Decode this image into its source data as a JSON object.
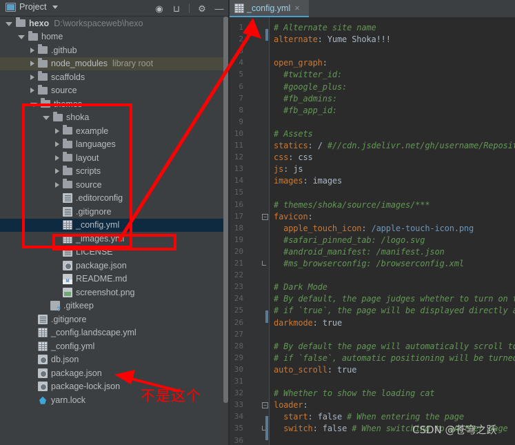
{
  "panel": {
    "title": "Project",
    "icons": [
      "target-icon",
      "collapse-all-icon",
      "settings-gear-icon",
      "minimize-icon"
    ]
  },
  "tree": [
    {
      "depth": 0,
      "arrow": "open",
      "icon": "folder",
      "name": "hexo",
      "bold": true,
      "suffix": "D:\\workspaceweb\\hexo",
      "suffix_kind": "path"
    },
    {
      "depth": 1,
      "arrow": "open",
      "icon": "folder",
      "name": "home"
    },
    {
      "depth": 2,
      "arrow": "closed",
      "icon": "folder",
      "name": ".github"
    },
    {
      "depth": 2,
      "arrow": "closed",
      "icon": "folder",
      "name": "node_modules",
      "suffix": "library root",
      "suffix_kind": "lib",
      "highlight": "lib"
    },
    {
      "depth": 2,
      "arrow": "closed",
      "icon": "folder",
      "name": "scaffolds"
    },
    {
      "depth": 2,
      "arrow": "closed",
      "icon": "folder",
      "name": "source"
    },
    {
      "depth": 2,
      "arrow": "open",
      "icon": "folder",
      "name": "themes"
    },
    {
      "depth": 3,
      "arrow": "open",
      "icon": "folder",
      "name": "shoka"
    },
    {
      "depth": 4,
      "arrow": "closed",
      "icon": "folder",
      "name": "example"
    },
    {
      "depth": 4,
      "arrow": "closed",
      "icon": "folder",
      "name": "languages"
    },
    {
      "depth": 4,
      "arrow": "closed",
      "icon": "folder",
      "name": "layout"
    },
    {
      "depth": 4,
      "arrow": "closed",
      "icon": "folder",
      "name": "scripts"
    },
    {
      "depth": 4,
      "arrow": "closed",
      "icon": "folder",
      "name": "source"
    },
    {
      "depth": 4,
      "arrow": "none",
      "icon": "txt",
      "name": ".editorconfig"
    },
    {
      "depth": 4,
      "arrow": "none",
      "icon": "txt",
      "name": ".gitignore"
    },
    {
      "depth": 4,
      "arrow": "none",
      "icon": "yml",
      "name": "_config.yml",
      "selected": true
    },
    {
      "depth": 4,
      "arrow": "none",
      "icon": "yml",
      "name": "_images.yml"
    },
    {
      "depth": 4,
      "arrow": "none",
      "icon": "txt",
      "name": "LICENSE"
    },
    {
      "depth": 4,
      "arrow": "none",
      "icon": "json",
      "name": "package.json"
    },
    {
      "depth": 4,
      "arrow": "none",
      "icon": "md",
      "name": "README.md"
    },
    {
      "depth": 4,
      "arrow": "none",
      "icon": "png",
      "name": "screenshot.png"
    },
    {
      "depth": 3,
      "arrow": "none",
      "icon": "unk",
      "name": ".gitkeep"
    },
    {
      "depth": 2,
      "arrow": "none",
      "icon": "txt",
      "name": ".gitignore"
    },
    {
      "depth": 2,
      "arrow": "none",
      "icon": "yml",
      "name": "_config.landscape.yml"
    },
    {
      "depth": 2,
      "arrow": "none",
      "icon": "yml",
      "name": "_config.yml"
    },
    {
      "depth": 2,
      "arrow": "none",
      "icon": "json",
      "name": "db.json"
    },
    {
      "depth": 2,
      "arrow": "none",
      "icon": "json",
      "name": "package.json"
    },
    {
      "depth": 2,
      "arrow": "none",
      "icon": "json",
      "name": "package-lock.json"
    },
    {
      "depth": 2,
      "arrow": "none",
      "icon": "yarn",
      "name": "yarn.lock"
    }
  ],
  "editor": {
    "tab": {
      "label": "_config.yml",
      "icon": "yml-file-icon",
      "close": "×"
    },
    "lines": [
      {
        "n": 1,
        "segs": [
          {
            "t": "# Alternate site name",
            "c": "c"
          }
        ]
      },
      {
        "n": 2,
        "segs": [
          {
            "t": "alternate",
            "c": "k"
          },
          {
            "t": ": ",
            "c": "p"
          },
          {
            "t": "Yume Shoka!!!",
            "c": "v"
          }
        ]
      },
      {
        "n": 3,
        "segs": []
      },
      {
        "n": 4,
        "segs": [
          {
            "t": "open_graph",
            "c": "k"
          },
          {
            "t": ":",
            "c": "p"
          }
        ]
      },
      {
        "n": 5,
        "segs": [
          {
            "t": "  #twitter_id:",
            "c": "c"
          }
        ]
      },
      {
        "n": 6,
        "segs": [
          {
            "t": "  #google_plus:",
            "c": "c"
          }
        ]
      },
      {
        "n": 7,
        "segs": [
          {
            "t": "  #fb_admins:",
            "c": "c"
          }
        ]
      },
      {
        "n": 8,
        "segs": [
          {
            "t": "  #fb_app_id:",
            "c": "c"
          }
        ]
      },
      {
        "n": 9,
        "segs": []
      },
      {
        "n": 10,
        "segs": [
          {
            "t": "# Assets",
            "c": "c"
          }
        ]
      },
      {
        "n": 11,
        "segs": [
          {
            "t": "statics",
            "c": "k"
          },
          {
            "t": ": ",
            "c": "p"
          },
          {
            "t": "/ ",
            "c": "v"
          },
          {
            "t": "#//cdn.jsdelivr.net/gh/username/Repository@version/",
            "c": "c"
          }
        ]
      },
      {
        "n": 12,
        "segs": [
          {
            "t": "css",
            "c": "k"
          },
          {
            "t": ": ",
            "c": "p"
          },
          {
            "t": "css",
            "c": "v"
          }
        ]
      },
      {
        "n": 13,
        "segs": [
          {
            "t": "js",
            "c": "k"
          },
          {
            "t": ": ",
            "c": "p"
          },
          {
            "t": "js",
            "c": "v"
          }
        ]
      },
      {
        "n": 14,
        "segs": [
          {
            "t": "images",
            "c": "k"
          },
          {
            "t": ": ",
            "c": "p"
          },
          {
            "t": "images",
            "c": "v"
          }
        ]
      },
      {
        "n": 15,
        "segs": []
      },
      {
        "n": 16,
        "segs": [
          {
            "t": "# themes/shoka/source/images/***",
            "c": "c"
          }
        ]
      },
      {
        "n": 17,
        "segs": [
          {
            "t": "favicon",
            "c": "k"
          },
          {
            "t": ":",
            "c": "p"
          }
        ],
        "fold": "open"
      },
      {
        "n": 18,
        "segs": [
          {
            "t": "  apple_touch_icon",
            "c": "k"
          },
          {
            "t": ": ",
            "c": "p"
          },
          {
            "t": "/apple-touch-icon.png",
            "c": "b"
          }
        ]
      },
      {
        "n": 19,
        "segs": [
          {
            "t": "  #safari_pinned_tab: /logo.svg",
            "c": "c"
          }
        ]
      },
      {
        "n": 20,
        "segs": [
          {
            "t": "  #android_manifest: /manifest.json",
            "c": "c"
          }
        ]
      },
      {
        "n": 21,
        "segs": [
          {
            "t": "  #ms_browserconfig: /browserconfig.xml",
            "c": "c"
          }
        ],
        "fold": "end"
      },
      {
        "n": 22,
        "segs": []
      },
      {
        "n": 23,
        "segs": [
          {
            "t": "# Dark Mode",
            "c": "c"
          }
        ]
      },
      {
        "n": 24,
        "segs": [
          {
            "t": "# By default, the page judges whether to turn on the dark mode",
            "c": "c"
          }
        ]
      },
      {
        "n": 25,
        "segs": [
          {
            "t": "# if `true`, the page will be displayed directly as dark mode",
            "c": "c"
          }
        ]
      },
      {
        "n": 26,
        "segs": [
          {
            "t": "darkmode",
            "c": "k"
          },
          {
            "t": ": ",
            "c": "p"
          },
          {
            "t": "true",
            "c": "v"
          }
        ]
      },
      {
        "n": 27,
        "segs": []
      },
      {
        "n": 28,
        "segs": [
          {
            "t": "# By default the page will automatically scroll to the position",
            "c": "c"
          }
        ]
      },
      {
        "n": 29,
        "segs": [
          {
            "t": "# if `false`, automatic positioning will be turned off",
            "c": "c"
          }
        ]
      },
      {
        "n": 30,
        "segs": [
          {
            "t": "auto_scroll",
            "c": "k"
          },
          {
            "t": ": ",
            "c": "p"
          },
          {
            "t": "true",
            "c": "v"
          }
        ]
      },
      {
        "n": 31,
        "segs": []
      },
      {
        "n": 32,
        "segs": [
          {
            "t": "# Whether to show the loading cat",
            "c": "c"
          }
        ]
      },
      {
        "n": 33,
        "segs": [
          {
            "t": "loader",
            "c": "k"
          },
          {
            "t": ":",
            "c": "p"
          }
        ],
        "fold": "open"
      },
      {
        "n": 34,
        "segs": [
          {
            "t": "  start",
            "c": "k"
          },
          {
            "t": ": ",
            "c": "p"
          },
          {
            "t": "false ",
            "c": "v"
          },
          {
            "t": "# When entering the page",
            "c": "c"
          }
        ]
      },
      {
        "n": 35,
        "segs": [
          {
            "t": "  switch",
            "c": "k"
          },
          {
            "t": ": ",
            "c": "p"
          },
          {
            "t": "false ",
            "c": "v"
          },
          {
            "t": "# When switching to another page",
            "c": "c"
          }
        ],
        "fold": "end"
      },
      {
        "n": 36,
        "segs": []
      }
    ]
  },
  "annotations": {
    "chinese_note": "不是这个",
    "watermark": "CSDN @苍穹之跃",
    "accent_red": "#ff0000",
    "tab_underline": "#4a9fd0",
    "selection_blue": "#0d2a40"
  }
}
